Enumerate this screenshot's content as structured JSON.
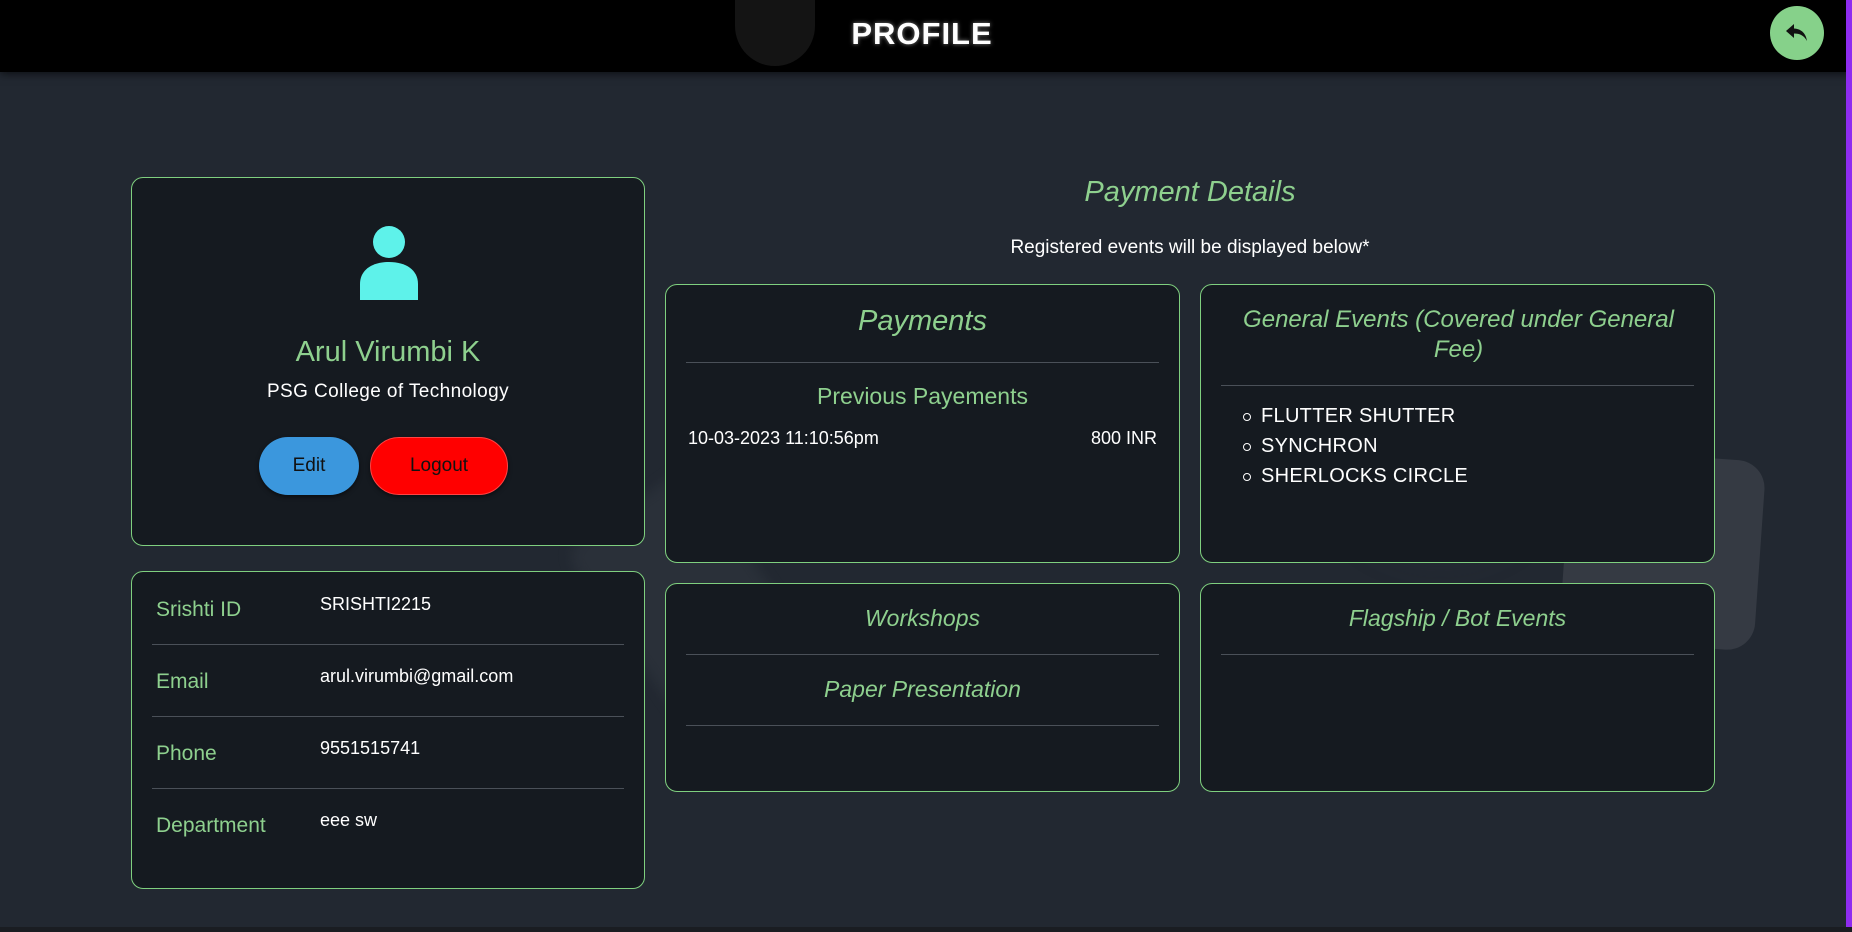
{
  "header": {
    "title": "PROFILE"
  },
  "profile": {
    "name": "Arul Virumbi K",
    "college": "PSG College of Technology",
    "edit_label": "Edit",
    "logout_label": "Logout"
  },
  "info": [
    {
      "label": "Srishti ID",
      "value": "SRISHTI2215"
    },
    {
      "label": "Email",
      "value": "arul.virumbi@gmail.com"
    },
    {
      "label": "Phone",
      "value": "9551515741"
    },
    {
      "label": "Department",
      "value": "eee sw"
    }
  ],
  "payment_details": {
    "title": "Payment Details",
    "subtitle": "Registered events will be displayed below*"
  },
  "payments": {
    "title": "Payments",
    "previous_label": "Previous Payements",
    "entries": [
      {
        "date": "10-03-2023 11:10:56pm",
        "amount": "800 INR"
      }
    ]
  },
  "general_events": {
    "title": "General Events (Covered under General Fee)",
    "items": [
      "FLUTTER SHUTTER",
      "SYNCHRON",
      "SHERLOCKS CIRCLE"
    ]
  },
  "workshops": {
    "title": "Workshops",
    "paper_title": "Paper Presentation"
  },
  "flagship": {
    "title": "Flagship / Bot Events"
  },
  "colors": {
    "accent": "#8ed08e",
    "edit": "#3b97dd",
    "logout": "#ff0000",
    "avatar": "#5ef2ea",
    "background": "#222831"
  },
  "icons": {
    "back": "reply-arrow-icon",
    "user": "user-avatar-icon"
  }
}
